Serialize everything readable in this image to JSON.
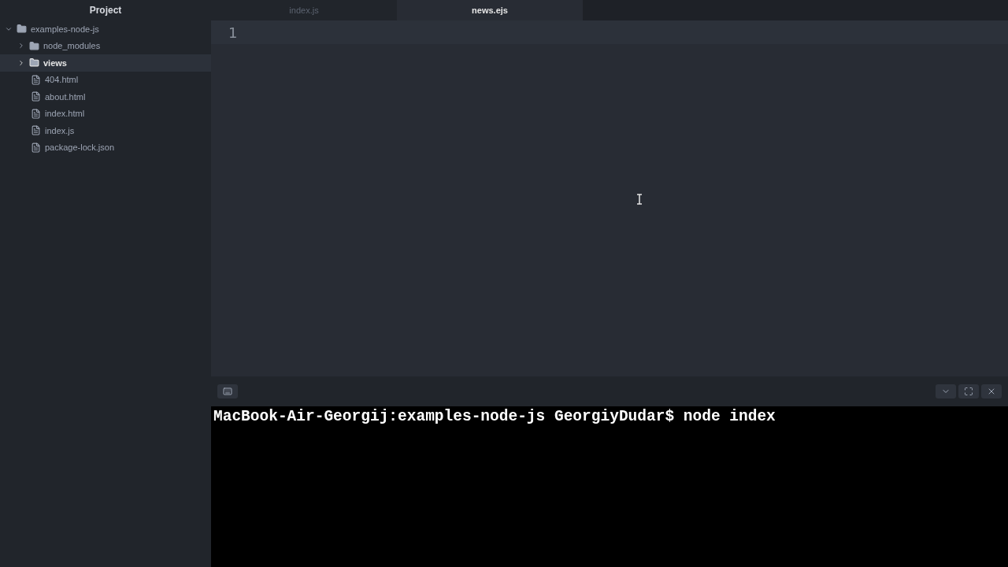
{
  "sidebar": {
    "title": "Project",
    "tree": [
      {
        "kind": "folder",
        "label": "examples-node-js",
        "expanded": true,
        "selected": false,
        "children": [
          {
            "kind": "folder",
            "label": "node_modules",
            "expanded": false,
            "selected": false
          },
          {
            "kind": "folder",
            "label": "views",
            "expanded": false,
            "selected": true
          },
          {
            "kind": "file",
            "label": "404.html",
            "selected": false
          },
          {
            "kind": "file",
            "label": "about.html",
            "selected": false
          },
          {
            "kind": "file",
            "label": "index.html",
            "selected": false
          },
          {
            "kind": "file",
            "label": "index.js",
            "selected": false
          },
          {
            "kind": "file",
            "label": "package-lock.json",
            "selected": false
          }
        ]
      }
    ]
  },
  "tabs": [
    {
      "label": "index.js",
      "selected": false
    },
    {
      "label": "news.ejs",
      "selected": true
    }
  ],
  "editor": {
    "line_numbers": [
      "1"
    ]
  },
  "terminal": {
    "lines": [
      "MacBook-Air-Georgij:examples-node-js GeorgiyDudar$ node index"
    ]
  }
}
